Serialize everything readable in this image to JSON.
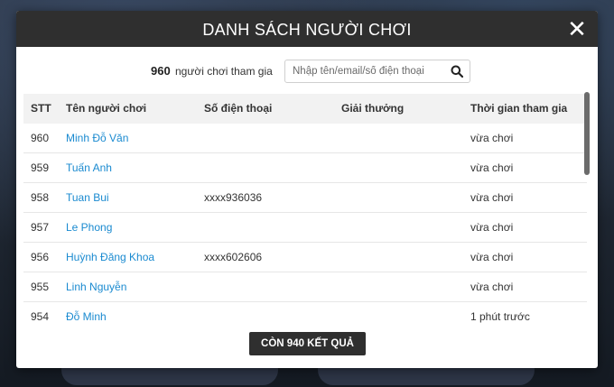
{
  "modal": {
    "title": "DANH SÁCH NGƯỜI CHƠI",
    "close_symbol": "✕"
  },
  "summary": {
    "count": "960",
    "label": "người chơi tham gia"
  },
  "search": {
    "placeholder": "Nhập tên/email/số điện thoại",
    "value": ""
  },
  "table": {
    "columns": [
      "STT",
      "Tên người chơi",
      "Số điện thoại",
      "Giải thưởng",
      "Thời gian tham gia"
    ],
    "rows": [
      {
        "stt": "960",
        "name": "Minh Đỗ Văn",
        "phone": "",
        "prize": "",
        "time": "vừa chơi"
      },
      {
        "stt": "959",
        "name": "Tuấn Anh",
        "phone": "",
        "prize": "",
        "time": "vừa chơi"
      },
      {
        "stt": "958",
        "name": "Tuan Bui",
        "phone": "xxxx936036",
        "prize": "",
        "time": "vừa chơi"
      },
      {
        "stt": "957",
        "name": "Le Phong",
        "phone": "",
        "prize": "",
        "time": "vừa chơi"
      },
      {
        "stt": "956",
        "name": "Huỳnh Đăng Khoa",
        "phone": "xxxx602606",
        "prize": "",
        "time": "vừa chơi"
      },
      {
        "stt": "955",
        "name": "Linh Nguyễn",
        "phone": "",
        "prize": "",
        "time": "vừa chơi"
      },
      {
        "stt": "954",
        "name": "Đỗ Minh",
        "phone": "",
        "prize": "",
        "time": "1 phút trước"
      }
    ]
  },
  "more_button": {
    "label": "CÒN 940 KẾT QUẢ"
  },
  "icons": {
    "close": "close-icon",
    "search": "search-icon"
  }
}
